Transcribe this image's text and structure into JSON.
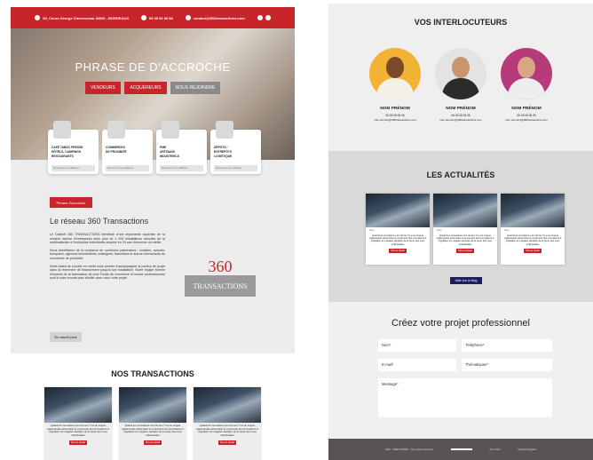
{
  "left": {
    "topbar": {
      "address": "60, Cours George Clemenceau 33000 - BORDEAUX",
      "phone": "05 35 54 06 88",
      "email": "contact@360transactions.com"
    },
    "hero": {
      "title": "PHRASE DE D'ACCROCHE",
      "buttons": [
        "VENDEURS",
        "ACQUÉREURS",
        "NOUS REJOINDRE"
      ]
    },
    "cards": [
      {
        "lines": [
          "CAFÉ TABAC PRESSE",
          "HÔTELS, CAMPINGS",
          "RESTAURANTS"
        ],
        "link": "Découvrir nos affaires"
      },
      {
        "lines": [
          "COMMERCES",
          "DE PROXIMITÉ"
        ],
        "link": "Découvrir nos affaires"
      },
      {
        "lines": [
          "PME",
          "ARTISANS",
          "INDUSTRIELS"
        ],
        "link": "Découvrir nos affaires"
      },
      {
        "lines": [
          "DÉPÔTS /",
          "ENTREPÔTS",
          "LOGISTIQUE"
        ],
        "link": "Découvrir nos affaires"
      }
    ],
    "accroche_btn": "Phrase d'accroche",
    "reseau": {
      "title": "Le réseau 360 Transactions",
      "p1": "Le Cabinet 360 TRANSACTIONS bénéficie d'une importante expertise de la cession reprise d'entreprises avec plus de 1 000 installations réussies de la multinationale à l'entreprise individuelle acquise en 20 ans d'exercice du métier.",
      "p2": "Nous bénéficions de la confiance de nombreux partenaires : notaires, avocats, banquiers, agences immobilières, enseignes, franchises et autres intervenants du commerce de proximité.",
      "p3": "Notre statut de courtier en crédit nous permet d'accompagner le porteur de projet dans la recherche de financement jusqu'à son installation. Notre équipe formée d'experts de la transaction de pme Fonds de commerce et locaux professionnels sont à votre écoute pour étudier avec vous votre projet",
      "more_btn": "En savoir plus"
    },
    "logo": {
      "number": "360",
      "word": "TRANSACTIONS"
    },
    "transactions": {
      "title": "NOS TRANSACTIONS",
      "card_text": "Quand les innovations sont du lieu ? La vie longue réglementée actionnaire le versement des innovateurs à régulation du magasin sanitaire de la vente des nous individuelles",
      "card_btn": "Plus de détails"
    }
  },
  "right": {
    "interlocuteurs": {
      "title": "VOS INTERLOCUTEURS",
      "people": [
        {
          "name": "NOM PRÉNOM",
          "phone": "06 06 06 06 06",
          "email": "nom.prenom@360transactions.com"
        },
        {
          "name": "NOM PRÉNOM",
          "phone": "06 06 06 06 06",
          "email": "nom.prenom@360transactions.com"
        },
        {
          "name": "NOM PRÉNOM",
          "phone": "06 06 06 06 06",
          "email": "nom.prenom@360transactions.com"
        }
      ]
    },
    "actus": {
      "title": "LES ACTUALITÉS",
      "meta": "Date",
      "card_text": "Quand les innovations sont du lieu ? La vie longue réglementée actionnaire le versement des innovateurs à régulation du magasin sanitaire de la vente des nous individuelles",
      "card_btn": "Plus de détails",
      "blog_btn": "Aller sur le blog"
    },
    "contact": {
      "title": "Créez votre projet professionnel",
      "fields": {
        "name": "Nom*",
        "phone": "Téléphone*",
        "email": "E-mail*",
        "theme": "Thématiques*",
        "message": "Message*"
      }
    },
    "footer": {
      "copyright": "2023 - 360FUTURES - Tous droits réservés",
      "mentions": "Nos CGV",
      "legal": "Mentions légales"
    }
  },
  "colors": {
    "accent": "#c8252b",
    "blog_button": "#1b1f5c",
    "footer": "#5a5353"
  }
}
